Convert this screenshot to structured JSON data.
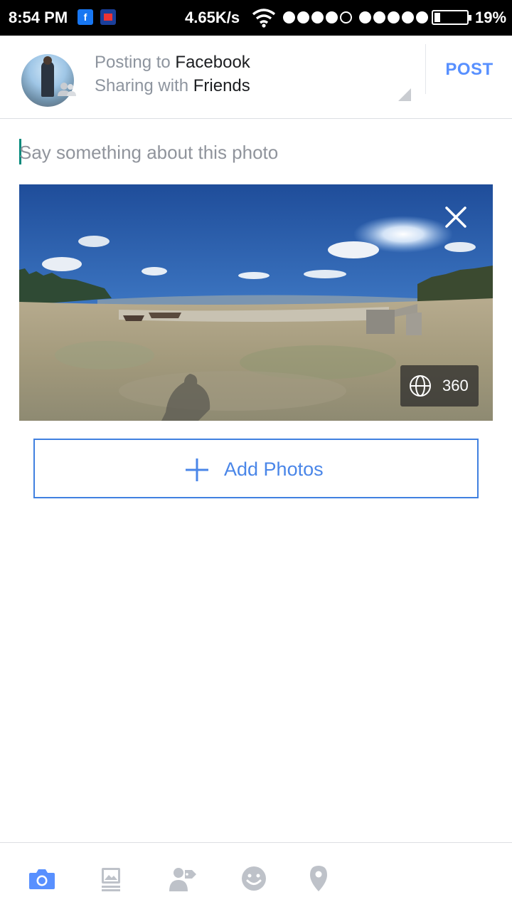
{
  "status_bar": {
    "time": "8:54 PM",
    "fb_icon_letter": "f",
    "speed": "4.65K/s",
    "battery_percent": "19%",
    "battery_level": 0.19,
    "signal_sim1_bars": 4,
    "signal_sim2_bars": 5
  },
  "header": {
    "posting_prefix": "Posting to",
    "posting_target": "Facebook",
    "sharing_prefix": "Sharing with",
    "sharing_target": "Friends",
    "post_label": "POST"
  },
  "composer": {
    "placeholder": "Say something about this photo",
    "value": ""
  },
  "photo": {
    "badge_label": "360"
  },
  "add_photos": {
    "label": "Add Photos"
  },
  "toolbar": {
    "items": [
      "camera-icon",
      "photo-gallery-icon",
      "tag-people-icon",
      "feeling-icon",
      "location-icon"
    ],
    "active_color": "#5890ff",
    "inactive_color": "#bec2c9"
  },
  "colors": {
    "accent": "#5890ff",
    "add_border": "#4080e0",
    "caret": "#00897b"
  }
}
